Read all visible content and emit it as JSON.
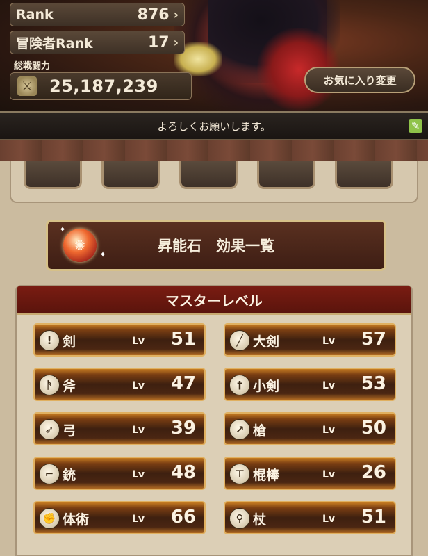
{
  "header": {
    "rank_label": "Rank",
    "rank_value": "876",
    "adventurer_rank_label": "冒険者Rank",
    "adventurer_rank_value": "17",
    "power_label": "総戦闘力",
    "power_value": "25,187,239",
    "favorite_button": "お気に入り変更"
  },
  "comment": "よろしくお願いします。",
  "effects_button": "昇能石　効果一覧",
  "master": {
    "title": "マスターレベル",
    "lv_label": "Lv",
    "weapons": [
      {
        "name": "剣",
        "level": "51",
        "icon": "sword-icon",
        "glyph": "!"
      },
      {
        "name": "大剣",
        "level": "57",
        "icon": "greatsword-icon",
        "glyph": "╱"
      },
      {
        "name": "斧",
        "level": "47",
        "icon": "axe-icon",
        "glyph": "ᚫ"
      },
      {
        "name": "小剣",
        "level": "53",
        "icon": "dagger-icon",
        "glyph": "†"
      },
      {
        "name": "弓",
        "level": "39",
        "icon": "bow-icon",
        "glyph": "➶"
      },
      {
        "name": "槍",
        "level": "50",
        "icon": "spear-icon",
        "glyph": "↗"
      },
      {
        "name": "銃",
        "level": "48",
        "icon": "gun-icon",
        "glyph": "⌐"
      },
      {
        "name": "棍棒",
        "level": "26",
        "icon": "club-icon",
        "glyph": "⊤"
      },
      {
        "name": "体術",
        "level": "66",
        "icon": "fist-icon",
        "glyph": "✊"
      },
      {
        "name": "杖",
        "level": "51",
        "icon": "staff-icon",
        "glyph": "⚲"
      }
    ]
  }
}
